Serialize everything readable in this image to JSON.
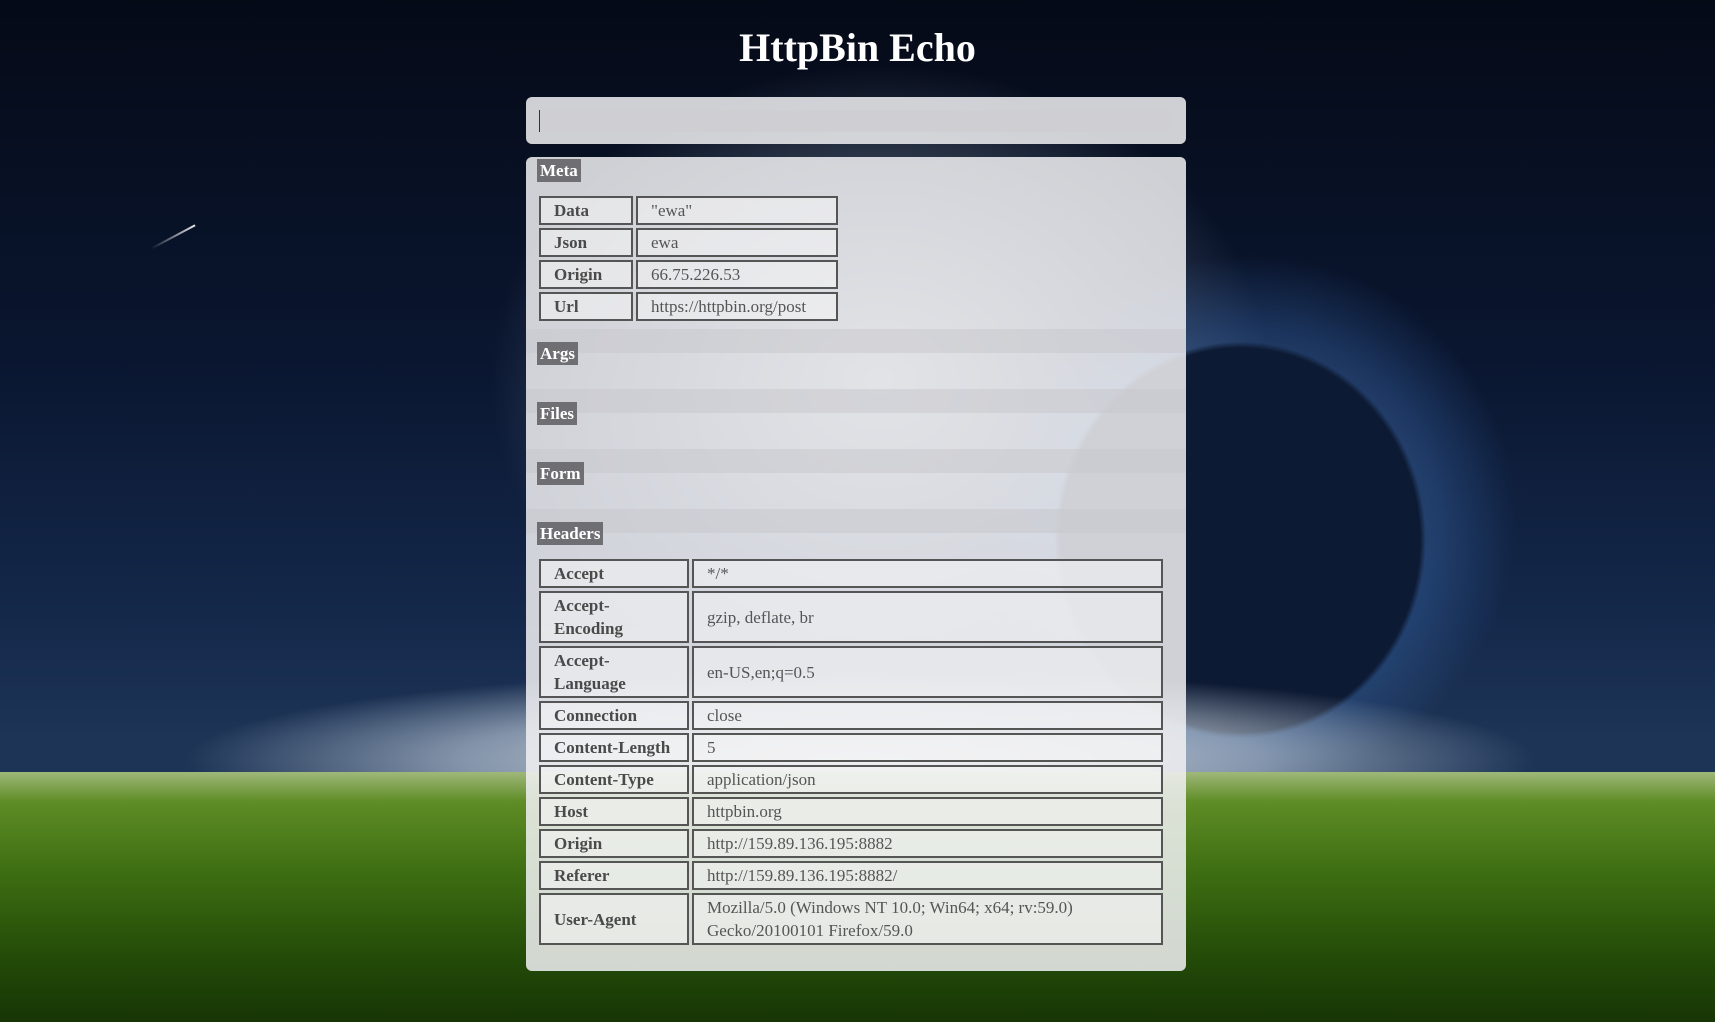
{
  "title": "HttpBin Echo",
  "search": {
    "value": "",
    "placeholder": ""
  },
  "sections": {
    "meta": "Meta",
    "args": "Args",
    "files": "Files",
    "form": "Form",
    "headers": "Headers"
  },
  "meta": [
    {
      "key": "Data",
      "value": "\"ewa\""
    },
    {
      "key": "Json",
      "value": "ewa"
    },
    {
      "key": "Origin",
      "value": "66.75.226.53"
    },
    {
      "key": "Url",
      "value": "https://httpbin.org/post"
    }
  ],
  "headers": [
    {
      "key": "Accept",
      "value": "*/*"
    },
    {
      "key": "Accept-Encoding",
      "value": "gzip, deflate, br"
    },
    {
      "key": "Accept-Language",
      "value": "en-US,en;q=0.5"
    },
    {
      "key": "Connection",
      "value": "close"
    },
    {
      "key": "Content-Length",
      "value": "5"
    },
    {
      "key": "Content-Type",
      "value": "application/json"
    },
    {
      "key": "Host",
      "value": "httpbin.org"
    },
    {
      "key": "Origin",
      "value": "http://159.89.136.195:8882"
    },
    {
      "key": "Referer",
      "value": "http://159.89.136.195:8882/"
    },
    {
      "key": "User-Agent",
      "value": "Mozilla/5.0 (Windows NT 10.0; Win64; x64; rv:59.0) Gecko/20100101 Firefox/59.0"
    }
  ]
}
